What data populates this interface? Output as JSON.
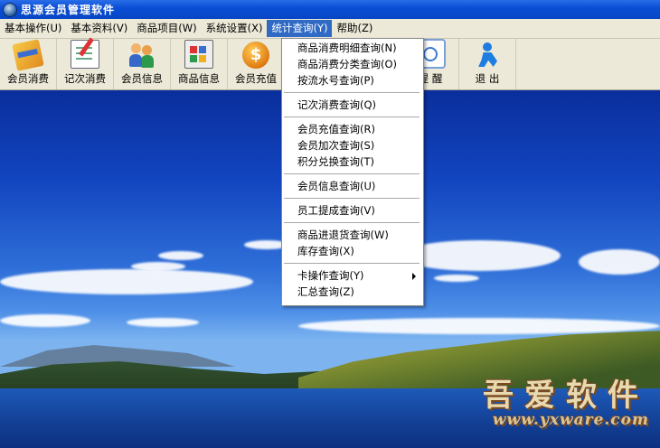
{
  "window": {
    "title": "思源会员管理软件"
  },
  "menubar": {
    "items": [
      {
        "label": "基本操作",
        "key": "(U)"
      },
      {
        "label": "基本资料",
        "key": "(V)"
      },
      {
        "label": "商品项目",
        "key": "(W)"
      },
      {
        "label": "系统设置",
        "key": "(X)"
      },
      {
        "label": "统计查询",
        "key": "(Y)"
      },
      {
        "label": "帮助",
        "key": "(Z)"
      }
    ]
  },
  "toolbar": {
    "buttons": [
      {
        "label": "会员消费",
        "icon": "card-icon"
      },
      {
        "label": "记次消费",
        "icon": "notepad-icon"
      },
      {
        "label": "会员信息",
        "icon": "people-icon"
      },
      {
        "label": "商品信息",
        "icon": "goods-icon"
      },
      {
        "label": "会员充值",
        "icon": "coin-icon"
      },
      {
        "label": "提 醒",
        "icon": "remind-icon"
      },
      {
        "label": "退 出",
        "icon": "exit-icon"
      }
    ]
  },
  "dropdown": {
    "items": [
      {
        "label": "商品消费明细查询",
        "key": "(N)"
      },
      {
        "label": "商品消费分类查询",
        "key": "(O)"
      },
      {
        "label": "按流水号查询",
        "key": "(P)"
      },
      {
        "label": "记次消费查询",
        "key": "(Q)"
      },
      {
        "label": "会员充值查询",
        "key": "(R)"
      },
      {
        "label": "会员加次查询",
        "key": "(S)"
      },
      {
        "label": "积分兑换查询",
        "key": "(T)"
      },
      {
        "label": "会员信息查询",
        "key": "(U)"
      },
      {
        "label": "员工提成查询",
        "key": "(V)"
      },
      {
        "label": "商品进退货查询",
        "key": "(W)"
      },
      {
        "label": "库存查询",
        "key": "(X)"
      },
      {
        "label": "卡操作查询",
        "key": "(Y)"
      },
      {
        "label": "汇总查询",
        "key": "(Z)"
      }
    ]
  },
  "watermark": {
    "name": "吾爱软件",
    "url": "www.yxware.com"
  }
}
